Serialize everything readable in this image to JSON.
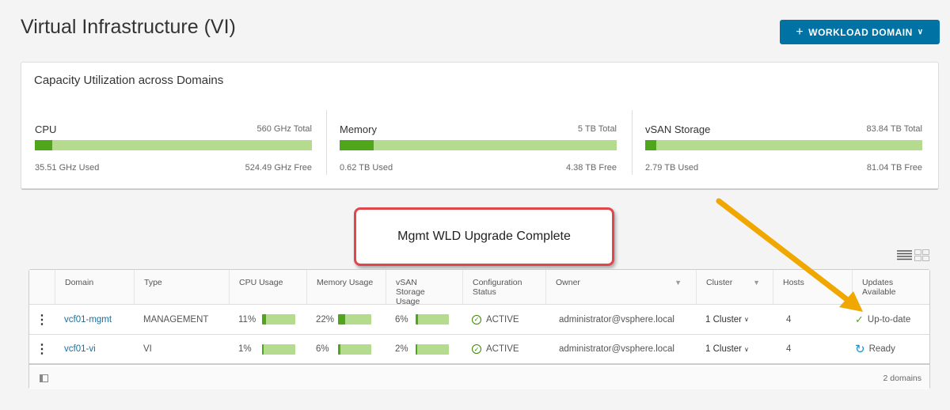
{
  "page_title": "Virtual Infrastructure (VI)",
  "workload_domain_button": "WORKLOAD DOMAIN",
  "capacity": {
    "title": "Capacity Utilization across Domains",
    "panels": [
      {
        "name": "CPU",
        "total": "560 GHz Total",
        "used": "35.51 GHz Used",
        "free": "524.49 GHz Free",
        "percent": 6.3
      },
      {
        "name": "Memory",
        "total": "5 TB Total",
        "used": "0.62 TB Used",
        "free": "4.38 TB Free",
        "percent": 12.4
      },
      {
        "name": "vSAN Storage",
        "total": "83.84 TB Total",
        "used": "2.79 TB Used",
        "free": "81.04 TB Free",
        "percent": 3.3
      }
    ]
  },
  "callout": "Mgmt WLD Upgrade Complete",
  "table": {
    "headers": [
      "Domain",
      "Type",
      "CPU Usage",
      "Memory Usage",
      "vSAN Storage Usage",
      "Configuration Status",
      "Owner",
      "Cluster",
      "Hosts",
      "Updates Available"
    ],
    "rows": [
      {
        "domain": "vcf01-mgmt",
        "type": "MANAGEMENT",
        "cpu": "11%",
        "cpu_pct": 11,
        "mem": "22%",
        "mem_pct": 22,
        "vsan": "6%",
        "vsan_pct": 6,
        "status": "ACTIVE",
        "owner": "administrator@vsphere.local",
        "cluster": "1 Cluster",
        "hosts": "4",
        "updates": "Up-to-date"
      },
      {
        "domain": "vcf01-vi",
        "type": "VI",
        "cpu": "1%",
        "cpu_pct": 1,
        "mem": "6%",
        "mem_pct": 6,
        "vsan": "2%",
        "vsan_pct": 2,
        "status": "ACTIVE",
        "owner": "administrator@vsphere.local",
        "cluster": "1 Cluster",
        "hosts": "4",
        "updates": "Ready"
      }
    ],
    "footer_count": "2 domains"
  },
  "colors": {
    "accent": "#0072a3",
    "bar_fill": "#4fa61a",
    "bar_bg": "#b5dc8e",
    "callout_border": "#e0474c",
    "arrow": "#f0a800"
  }
}
